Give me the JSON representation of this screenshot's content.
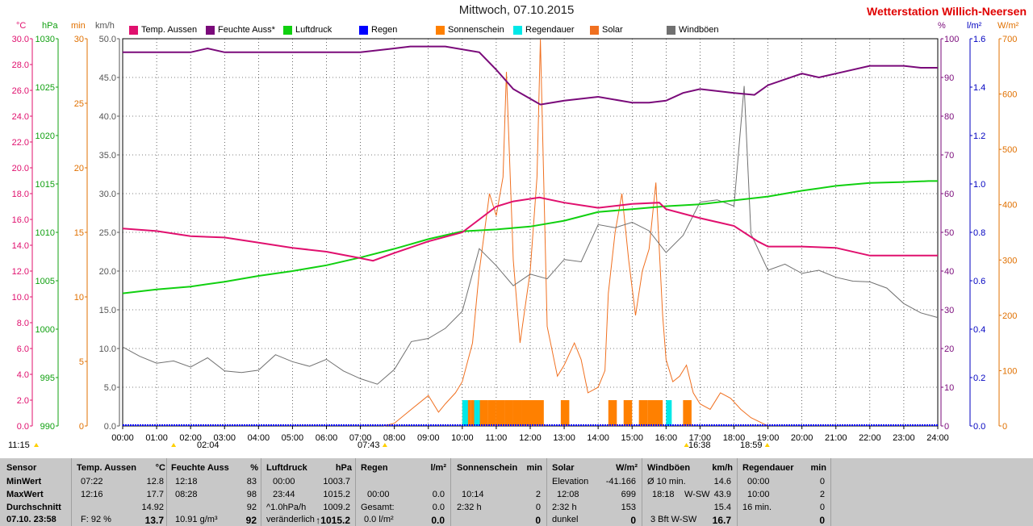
{
  "header": {
    "title": "Mittwoch, 07.10.2015",
    "station": "Wetterstation Willich-Neersen",
    "left_units": [
      "°C",
      "hPa",
      "min",
      "km/h"
    ],
    "right_units": [
      "%",
      "l/m²",
      "W/m²"
    ]
  },
  "legend": [
    {
      "label": "Temp. Aussen",
      "color": "#e0106e"
    },
    {
      "label": "Feuchte Auss*",
      "color": "#7a0a7a"
    },
    {
      "label": "Luftdruck",
      "color": "#10d010"
    },
    {
      "label": "Regen",
      "color": "#0000ff"
    },
    {
      "label": "Sonnenschein",
      "color": "#ff8000"
    },
    {
      "label": "Regendauer",
      "color": "#00e8e8"
    },
    {
      "label": "Solar",
      "color": "#f07020"
    },
    {
      "label": "Windböen",
      "color": "#707070"
    }
  ],
  "chart_data": {
    "type": "line",
    "x_ticks": [
      "00:00",
      "01:00",
      "02:00",
      "03:00",
      "04:00",
      "05:00",
      "06:00",
      "07:00",
      "08:00",
      "09:00",
      "10:00",
      "11:00",
      "12:00",
      "13:00",
      "14:00",
      "15:00",
      "16:00",
      "17:00",
      "18:00",
      "19:00",
      "20:00",
      "21:00",
      "22:00",
      "23:00",
      "24:00"
    ],
    "axes": {
      "temp": {
        "unit": "°C",
        "color": "#e0106e",
        "range": [
          0,
          30
        ],
        "ticks": [
          "0.0",
          "2.0",
          "4.0",
          "6.0",
          "8.0",
          "10.0",
          "12.0",
          "14.0",
          "16.0",
          "18.0",
          "20.0",
          "22.0",
          "24.0",
          "26.0",
          "28.0",
          "30.0"
        ]
      },
      "pressure": {
        "unit": "hPa",
        "color": "#10a010",
        "range": [
          990,
          1030
        ],
        "ticks": [
          "990",
          "995",
          "1000",
          "1005",
          "1010",
          "1015",
          "1020",
          "1025",
          "1030"
        ]
      },
      "sunshine": {
        "unit": "min",
        "color": "#e07000",
        "range": [
          0,
          30
        ],
        "ticks": [
          "0",
          "5",
          "10",
          "15",
          "20",
          "25",
          "30"
        ]
      },
      "wind": {
        "unit": "km/h",
        "color": "#555555",
        "range": [
          0,
          50
        ],
        "ticks": [
          "0.0",
          "5.0",
          "10.0",
          "15.0",
          "20.0",
          "25.0",
          "30.0",
          "35.0",
          "40.0",
          "45.0",
          "50.0"
        ]
      },
      "humidity": {
        "unit": "%",
        "color": "#7a0a7a",
        "range": [
          0,
          100
        ],
        "ticks": [
          "0",
          "10",
          "20",
          "30",
          "40",
          "50",
          "60",
          "70",
          "80",
          "90",
          "100"
        ]
      },
      "rain": {
        "unit": "l/m²",
        "color": "#0000c0",
        "range": [
          0,
          1.6
        ],
        "ticks": [
          "0.0",
          "0.2",
          "0.4",
          "0.6",
          "0.8",
          "1.0",
          "1.2",
          "1.4",
          "1.6"
        ]
      },
      "solar": {
        "unit": "W/m²",
        "color": "#e07000",
        "range": [
          0,
          700
        ],
        "ticks": [
          "0",
          "100",
          "200",
          "300",
          "400",
          "500",
          "600",
          "700"
        ]
      }
    },
    "series": [
      {
        "name": "Temp. Aussen",
        "axis": "temp",
        "color": "#e0106e",
        "points": [
          [
            0,
            15.3
          ],
          [
            1,
            15.1
          ],
          [
            2,
            14.7
          ],
          [
            3,
            14.6
          ],
          [
            4,
            14.2
          ],
          [
            5,
            13.8
          ],
          [
            6,
            13.5
          ],
          [
            7,
            13.0
          ],
          [
            7.37,
            12.8
          ],
          [
            8,
            13.4
          ],
          [
            9,
            14.3
          ],
          [
            10,
            15.0
          ],
          [
            10.5,
            16.0
          ],
          [
            11,
            17.0
          ],
          [
            11.5,
            17.4
          ],
          [
            12.27,
            17.7
          ],
          [
            13,
            17.3
          ],
          [
            14,
            16.9
          ],
          [
            15,
            17.2
          ],
          [
            15.8,
            17.3
          ],
          [
            16,
            16.8
          ],
          [
            17,
            16.1
          ],
          [
            18,
            15.5
          ],
          [
            18.7,
            14.3
          ],
          [
            19,
            13.9
          ],
          [
            20,
            13.9
          ],
          [
            21,
            13.8
          ],
          [
            22,
            13.2
          ],
          [
            23,
            13.2
          ],
          [
            24,
            13.2
          ]
        ]
      },
      {
        "name": "Feuchte Auss*",
        "axis": "humidity",
        "color": "#7a0a7a",
        "points": [
          [
            0,
            96.5
          ],
          [
            2,
            96.5
          ],
          [
            2.5,
            97.5
          ],
          [
            3,
            96.5
          ],
          [
            4,
            96.5
          ],
          [
            7,
            96.5
          ],
          [
            8,
            97.5
          ],
          [
            8.47,
            98
          ],
          [
            9.5,
            98
          ],
          [
            10.5,
            96.5
          ],
          [
            11,
            92
          ],
          [
            11.5,
            87
          ],
          [
            12,
            84.5
          ],
          [
            12.3,
            83
          ],
          [
            13,
            84
          ],
          [
            14,
            85
          ],
          [
            15,
            83.5
          ],
          [
            15.5,
            83.5
          ],
          [
            16,
            84
          ],
          [
            16.5,
            86
          ],
          [
            17,
            87
          ],
          [
            18,
            86
          ],
          [
            18.6,
            85.5
          ],
          [
            19,
            88
          ],
          [
            20,
            91
          ],
          [
            20.5,
            90
          ],
          [
            21,
            91
          ],
          [
            22,
            93
          ],
          [
            23,
            93
          ],
          [
            23.5,
            92.5
          ],
          [
            24,
            92.5
          ]
        ]
      },
      {
        "name": "Luftdruck",
        "axis": "pressure",
        "color": "#10d010",
        "points": [
          [
            0,
            1003.7
          ],
          [
            1,
            1004.1
          ],
          [
            2,
            1004.4
          ],
          [
            3,
            1004.9
          ],
          [
            4,
            1005.5
          ],
          [
            5,
            1006.0
          ],
          [
            6,
            1006.6
          ],
          [
            7,
            1007.4
          ],
          [
            8,
            1008.3
          ],
          [
            9,
            1009.3
          ],
          [
            10,
            1010.1
          ],
          [
            11,
            1010.3
          ],
          [
            12,
            1010.6
          ],
          [
            13,
            1011.2
          ],
          [
            14,
            1012.1
          ],
          [
            15,
            1012.4
          ],
          [
            16,
            1012.7
          ],
          [
            17,
            1012.9
          ],
          [
            18,
            1013.3
          ],
          [
            19,
            1013.7
          ],
          [
            20,
            1014.3
          ],
          [
            21,
            1014.8
          ],
          [
            22,
            1015.1
          ],
          [
            23,
            1015.2
          ],
          [
            23.73,
            1015.3
          ],
          [
            24,
            1015.3
          ]
        ]
      },
      {
        "name": "Windböen",
        "axis": "wind",
        "color": "#707070",
        "points": [
          [
            0,
            10.2
          ],
          [
            0.5,
            9.0
          ],
          [
            1,
            8.1
          ],
          [
            1.5,
            8.4
          ],
          [
            2,
            7.6
          ],
          [
            2.5,
            8.8
          ],
          [
            3,
            7.1
          ],
          [
            3.5,
            6.9
          ],
          [
            4,
            7.2
          ],
          [
            4.5,
            9.2
          ],
          [
            5,
            8.3
          ],
          [
            5.5,
            7.7
          ],
          [
            6,
            8.6
          ],
          [
            6.5,
            7.1
          ],
          [
            7,
            6.1
          ],
          [
            7.5,
            5.4
          ],
          [
            8,
            7.3
          ],
          [
            8.5,
            10.9
          ],
          [
            9,
            11.3
          ],
          [
            9.5,
            12.6
          ],
          [
            10,
            14.8
          ],
          [
            10.5,
            22.9
          ],
          [
            11,
            20.7
          ],
          [
            11.5,
            18.1
          ],
          [
            12,
            19.6
          ],
          [
            12.5,
            19.0
          ],
          [
            13,
            21.5
          ],
          [
            13.5,
            21.2
          ],
          [
            14,
            26.0
          ],
          [
            14.5,
            25.6
          ],
          [
            15,
            26.3
          ],
          [
            15.5,
            25.2
          ],
          [
            16,
            22.4
          ],
          [
            16.5,
            24.6
          ],
          [
            17,
            28.9
          ],
          [
            17.5,
            29.2
          ],
          [
            18,
            28.4
          ],
          [
            18.3,
            43.9
          ],
          [
            18.5,
            24.8
          ],
          [
            19,
            20.1
          ],
          [
            19.5,
            20.9
          ],
          [
            20,
            19.7
          ],
          [
            20.5,
            20.1
          ],
          [
            21,
            19.2
          ],
          [
            21.5,
            18.7
          ],
          [
            22,
            18.6
          ],
          [
            22.5,
            17.8
          ],
          [
            23,
            15.8
          ],
          [
            23.5,
            14.6
          ],
          [
            24,
            14.0
          ]
        ]
      },
      {
        "name": "Solar",
        "axis": "solar",
        "color": "#f07020",
        "points": [
          [
            7.7,
            0
          ],
          [
            8,
            5
          ],
          [
            8.5,
            30
          ],
          [
            9,
            55
          ],
          [
            9.3,
            25
          ],
          [
            9.5,
            40
          ],
          [
            9.8,
            60
          ],
          [
            10,
            80
          ],
          [
            10.3,
            150
          ],
          [
            10.5,
            280
          ],
          [
            10.8,
            420
          ],
          [
            11,
            380
          ],
          [
            11.2,
            450
          ],
          [
            11.3,
            640
          ],
          [
            11.5,
            300
          ],
          [
            11.7,
            150
          ],
          [
            12,
            280
          ],
          [
            12.2,
            450
          ],
          [
            12.3,
            699
          ],
          [
            12.5,
            180
          ],
          [
            12.8,
            90
          ],
          [
            13,
            110
          ],
          [
            13.3,
            150
          ],
          [
            13.5,
            120
          ],
          [
            13.7,
            60
          ],
          [
            14,
            70
          ],
          [
            14.2,
            100
          ],
          [
            14.3,
            240
          ],
          [
            14.5,
            350
          ],
          [
            14.7,
            420
          ],
          [
            14.9,
            300
          ],
          [
            15.1,
            200
          ],
          [
            15.3,
            280
          ],
          [
            15.5,
            320
          ],
          [
            15.7,
            440
          ],
          [
            15.9,
            200
          ],
          [
            16,
            120
          ],
          [
            16.2,
            80
          ],
          [
            16.4,
            90
          ],
          [
            16.6,
            110
          ],
          [
            16.8,
            60
          ],
          [
            17,
            40
          ],
          [
            17.3,
            30
          ],
          [
            17.6,
            60
          ],
          [
            17.9,
            50
          ],
          [
            18.2,
            30
          ],
          [
            18.5,
            15
          ],
          [
            18.9,
            3
          ],
          [
            19,
            0
          ]
        ]
      }
    ],
    "bars": {
      "sunshine_minutes": [
        [
          10,
          2
        ],
        [
          10.25,
          2
        ],
        [
          10.5,
          2
        ],
        [
          10.75,
          2
        ],
        [
          11,
          2
        ],
        [
          11.25,
          2
        ],
        [
          11.5,
          2
        ],
        [
          11.75,
          2
        ],
        [
          12,
          2
        ],
        [
          12.15,
          2
        ],
        [
          12.9,
          2
        ],
        [
          14.3,
          2
        ],
        [
          14.75,
          2
        ],
        [
          15.2,
          2
        ],
        [
          15.45,
          2
        ],
        [
          15.65,
          2
        ],
        [
          16.5,
          2
        ]
      ],
      "rain_duration": [
        [
          10,
          2
        ],
        [
          10.35,
          2
        ],
        [
          16,
          2
        ]
      ]
    },
    "markers": {
      "sunrise": "07:43",
      "sunset": "18:59",
      "temp_min_time": "02:04",
      "temp_max_time": "16:38",
      "last": "11:15"
    }
  },
  "stats": {
    "row_labels": [
      "Sensor",
      "MinWert",
      "MaxWert",
      "Durchschnitt",
      "07.10. 23:58"
    ],
    "temp": {
      "header": "Temp. Aussen",
      "unit": "°C",
      "min_time": "07:22",
      "min": "12.8",
      "max_time": "12:16",
      "max": "17.7",
      "avg": "14.92",
      "now_label": "F: 92 %",
      "now": "13.7"
    },
    "humidity": {
      "header": "Feuchte Auss",
      "unit": "%",
      "min_time": "12:18",
      "min": "83",
      "max_time": "08:28",
      "max": "98",
      "avg": "92",
      "now_label": "10.91 g/m³",
      "now": "92"
    },
    "pressure": {
      "header": "Luftdruck",
      "unit": "hPa",
      "min_time": "00:00",
      "min": "1003.7",
      "max_time": "23:44",
      "max": "1015.2",
      "avg_label": "^1.0hPa/h",
      "avg": "1009.2",
      "now_label": "veränderlich",
      "now": "↑1015.2"
    },
    "rain": {
      "header": "Regen",
      "unit": "l/m²",
      "min": "",
      "max_time": "00:00",
      "max": "0.0",
      "avg_label": "Gesamt:",
      "avg": "0.0",
      "now_label": "0.0 l/m²",
      "now": "0.0"
    },
    "sunshine": {
      "header": "Sonnenschein",
      "unit": "min",
      "max_time": "10:14",
      "max": "2",
      "avg_label": "2:32 h",
      "avg": "0",
      "now": "0"
    },
    "solar": {
      "header": "Solar",
      "unit": "W/m²",
      "min_label": "Elevation",
      "min": "-41.166",
      "max_time": "12:08",
      "max": "699",
      "avg_label": "2:32 h",
      "avg": "153",
      "now_label": "dunkel",
      "now": "0"
    },
    "wind": {
      "header": "Windböen",
      "unit": "km/h",
      "min_label": "Ø 10 min.",
      "min": "14.6",
      "max_time": "18:18",
      "max_label": "W-SW",
      "max": "43.9",
      "avg": "15.4",
      "now_label": "3 Bft W-SW",
      "now": "16.7"
    },
    "rainduration": {
      "header": "Regendauer",
      "unit": "min",
      "min_time": "00:00",
      "min": "0",
      "max_time": "10:00",
      "max": "2",
      "avg_label": "16 min.",
      "avg": "0",
      "now": "0"
    }
  }
}
